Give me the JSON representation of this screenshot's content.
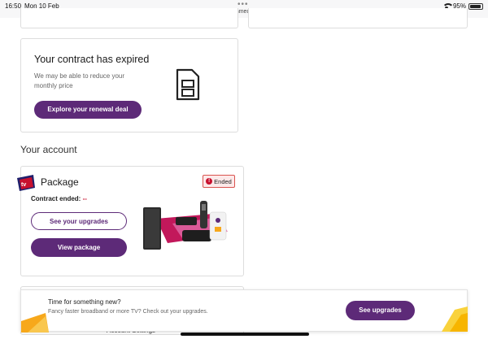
{
  "statusbar": {
    "time": "16:50",
    "date": "Mon 10 Feb",
    "url": "virginmedia.com",
    "battery": "95%",
    "battery_level": 0.95,
    "dots": "•••"
  },
  "contract": {
    "title": "Your contract has expired",
    "text": "We may be able to reduce your monthly price",
    "button": "Explore your renewal deal",
    "icon": "document-icon"
  },
  "account": {
    "section_title": "Your account",
    "package_title": "Package",
    "badge": "Ended",
    "badge_icon": "!",
    "contract_ended_label": "Contract ended:",
    "contract_ended_value": "--",
    "upgrades_button": "See your upgrades",
    "view_button": "View package",
    "account_settings": "Account Settings"
  },
  "banner": {
    "title": "Time for something new?",
    "text": "Fancy faster broadband or more TV? Check out your upgrades.",
    "button": "See upgrades"
  },
  "colors": {
    "accent": "#5d2a78",
    "ended": "#c8102e",
    "brand_orange": "#f7a81b",
    "brand_pink": "#d63384"
  }
}
